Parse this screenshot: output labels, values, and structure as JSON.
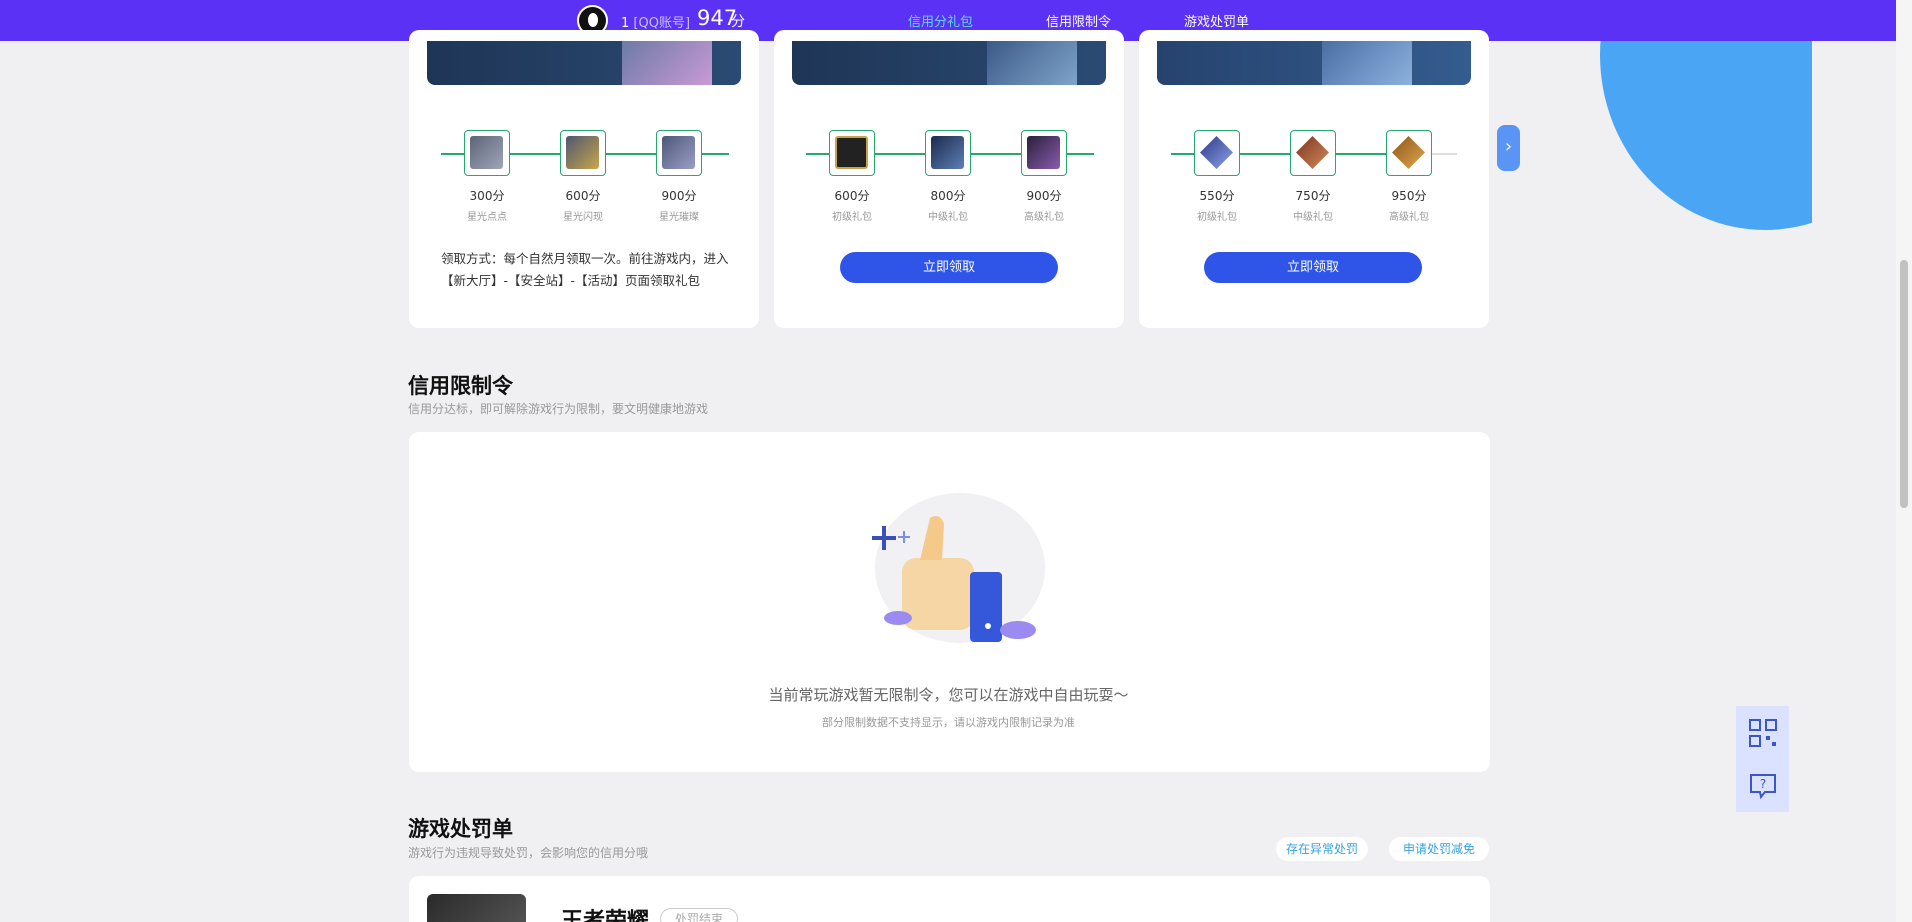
{
  "header": {
    "account_id": "1",
    "account_type": "[QQ账号]",
    "score": "947",
    "score_unit": "分",
    "nav": [
      "信用分礼包",
      "信用限制令",
      "游戏处罚单"
    ]
  },
  "gift_cards": [
    {
      "tiers": [
        {
          "points": "300分",
          "level": "星光点点"
        },
        {
          "points": "600分",
          "level": "星光闪现"
        },
        {
          "points": "900分",
          "level": "星光璀璨"
        }
      ],
      "howto": "领取方式：每个自然月领取一次。前往游戏内，进入【新大厅】-【安全站】-【活动】页面领取礼包"
    },
    {
      "tiers": [
        {
          "points": "600分",
          "level": "初级礼包"
        },
        {
          "points": "800分",
          "level": "中级礼包"
        },
        {
          "points": "900分",
          "level": "高级礼包"
        }
      ],
      "button": "立即领取"
    },
    {
      "tiers": [
        {
          "points": "550分",
          "level": "初级礼包"
        },
        {
          "points": "750分",
          "level": "中级礼包"
        },
        {
          "points": "950分",
          "level": "高级礼包"
        }
      ],
      "button": "立即领取"
    }
  ],
  "restriction": {
    "title": "信用限制令",
    "subtitle": "信用分达标，即可解除游戏行为限制，要文明健康地游戏",
    "empty_text": "当前常玩游戏暂无限制令，您可以在游戏中自由玩耍～",
    "empty_sub": "部分限制数据不支持显示，请以游戏内限制记录为准"
  },
  "penalty": {
    "title": "游戏处罚单",
    "subtitle": "游戏行为违规导致处罚，会影响您的信用分哦",
    "btn_abnormal": "存在异常处罚",
    "btn_reduce": "申请处罚减免",
    "game_name": "王者荣耀",
    "game_tag": "处罚结束"
  },
  "colors": {
    "topbar": "#5b32f5",
    "accent": "#2e55e8",
    "rail": "#24a86c"
  },
  "icons": [
    "qrcode-icon",
    "help-chat-icon",
    "chevron-right-icon"
  ]
}
